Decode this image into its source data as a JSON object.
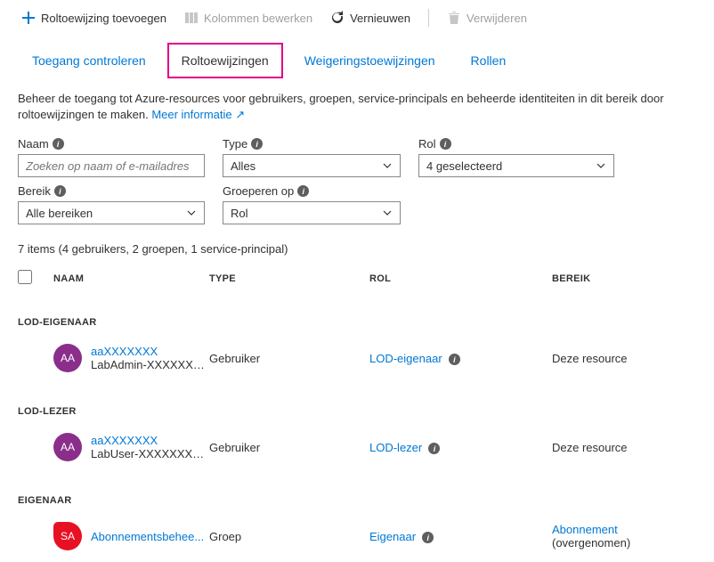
{
  "toolbar": {
    "add": "Roltoewijzing toevoegen",
    "editCols": "Kolommen bewerken",
    "refresh": "Vernieuwen",
    "delete": "Verwijderen"
  },
  "tabs": {
    "check": "Toegang controleren",
    "roles": "Roltoewijzingen",
    "deny": "Weigeringstoewijzingen",
    "rolesOnly": "Rollen"
  },
  "desc": {
    "text": "Beheer de toegang tot Azure-resources voor gebruikers, groepen, service-principals en beheerde identiteiten in dit bereik door roltoewijzingen te maken. ",
    "link": "Meer informatie"
  },
  "filters": {
    "nameLabel": "Naam",
    "namePlaceholder": "Zoeken op naam of e-mailadres",
    "typeLabel": "Type",
    "typeValue": "Alles",
    "roleLabel": "Rol",
    "roleValue": "4 geselecteerd",
    "scopeLabel": "Bereik",
    "scopeValue": "Alle bereiken",
    "groupLabel": "Groeperen op",
    "groupValue": "Rol"
  },
  "count": "7 items (4 gebruikers, 2 groepen, 1 service-principal)",
  "columns": {
    "name": "NAAM",
    "type": "TYPE",
    "role": "ROL",
    "scope": "BEREIK"
  },
  "groups": [
    {
      "header": "LOD-EIGENAAR",
      "rows": [
        {
          "initials": "AA",
          "avatarClass": "av-purple",
          "name": "aaXXXXXXX",
          "sub": "LabAdmin-XXXXXXX...",
          "type": "Gebruiker",
          "role": "LOD-eigenaar",
          "scope": "Deze resource",
          "scopeLink": false,
          "extra": ""
        }
      ]
    },
    {
      "header": "LOD-LEZER",
      "rows": [
        {
          "initials": "AA",
          "avatarClass": "av-purple",
          "name": "aaXXXXXXX",
          "sub": "LabUser-XXXXXXX@...",
          "type": "Gebruiker",
          "role": "LOD-lezer",
          "scope": "Deze resource",
          "scopeLink": false,
          "extra": ""
        }
      ]
    },
    {
      "header": "EIGENAAR",
      "rows": [
        {
          "initials": "SA",
          "avatarClass": "av-red",
          "name": "Abonnementsbehee...",
          "sub": "",
          "type": "Groep",
          "role": "Eigenaar",
          "scope": "Abonnement",
          "scopeLink": true,
          "extra": " (overgenomen)"
        }
      ]
    }
  ]
}
